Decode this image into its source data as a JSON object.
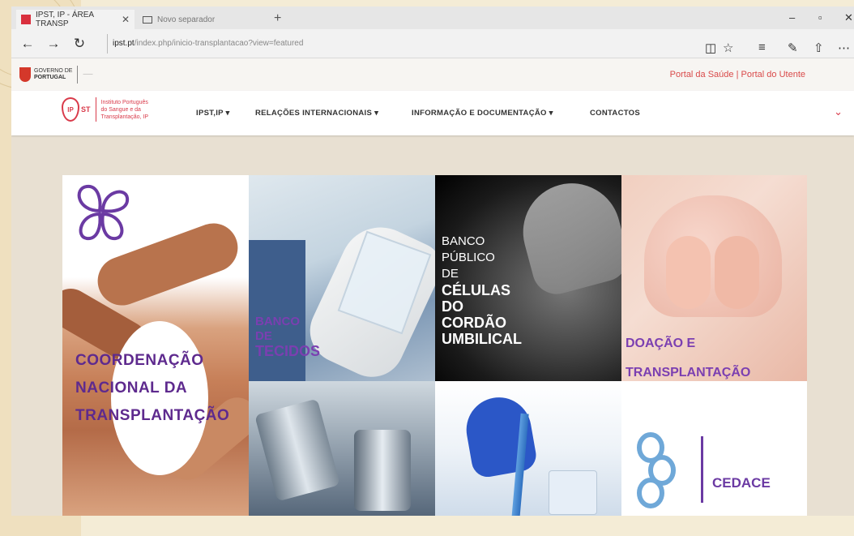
{
  "browser": {
    "active_tab": "IPST, IP - ÁREA TRANSP",
    "inactive_tab": "Novo separador",
    "url_domain": "ipst.pt",
    "url_path": "/index.php/inicio-transplantacao?view=featured"
  },
  "gov": {
    "logo_line1": "GOVERNO DE",
    "logo_line2": "PORTUGAL",
    "portals": "Portal da Saúde | Portal do Utente"
  },
  "site": {
    "logo_initials_top": "IP",
    "logo_initials_bottom": "ST",
    "logo_text_1": "Instituto Português",
    "logo_text_2": "do Sangue e da",
    "logo_text_3": "Transplantação, IP",
    "menu": [
      "IPST,IP ▾",
      "RELAÇÕES INTERNACIONAIS ▾",
      "INFORMAÇÃO E DOCUMENTAÇÃO ▾",
      "CONTACTOS"
    ]
  },
  "tiles": {
    "coord": {
      "l1": "COORDENAÇÃO",
      "l2": "NACIONAL DA",
      "l3": "TRANSPLANTAÇÃO"
    },
    "tecidos": {
      "l1": "BANCO",
      "l2": "DE",
      "l3": "TECIDOS"
    },
    "cordao": {
      "l1": "BANCO",
      "l2": "PÚBLICO",
      "l3": "DE",
      "l4": "CÉLULAS",
      "l5": "DO",
      "l6": "CORDÃO",
      "l7": "UMBILICAL"
    },
    "doacao": {
      "l1": "DOAÇÃO E",
      "l2": "TRANSPLANTAÇÃO"
    },
    "cedace": "CEDACE"
  },
  "colors": {
    "accent_red": "#d93a4a",
    "purple": "#6b3aa3"
  }
}
